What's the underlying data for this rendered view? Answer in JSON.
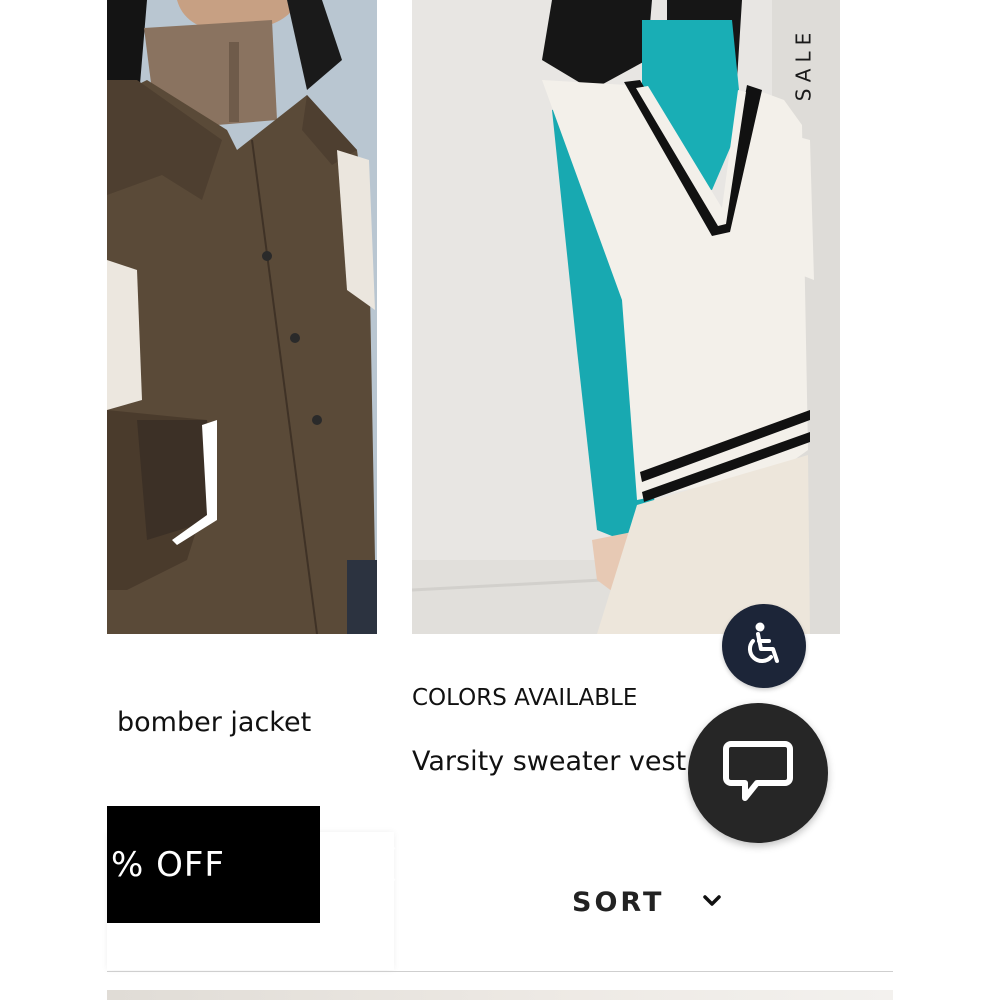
{
  "products": [
    {
      "name": "bomber jacket"
    },
    {
      "name": "Varsity sweater vest",
      "tag": "SALE",
      "colors_label": "COLORS AVAILABLE"
    }
  ],
  "promo": {
    "text": "% OFF"
  },
  "toolbar": {
    "sort_label": "SORT"
  },
  "icons": {
    "close": "close-icon",
    "sort": "chevron-down-icon",
    "accessibility": "wheelchair-icon",
    "chat": "chat-bubble-icon"
  },
  "colors": {
    "accessibility_bg": "#1c2538",
    "chat_bg": "#262626",
    "promo_bg": "#000000"
  }
}
